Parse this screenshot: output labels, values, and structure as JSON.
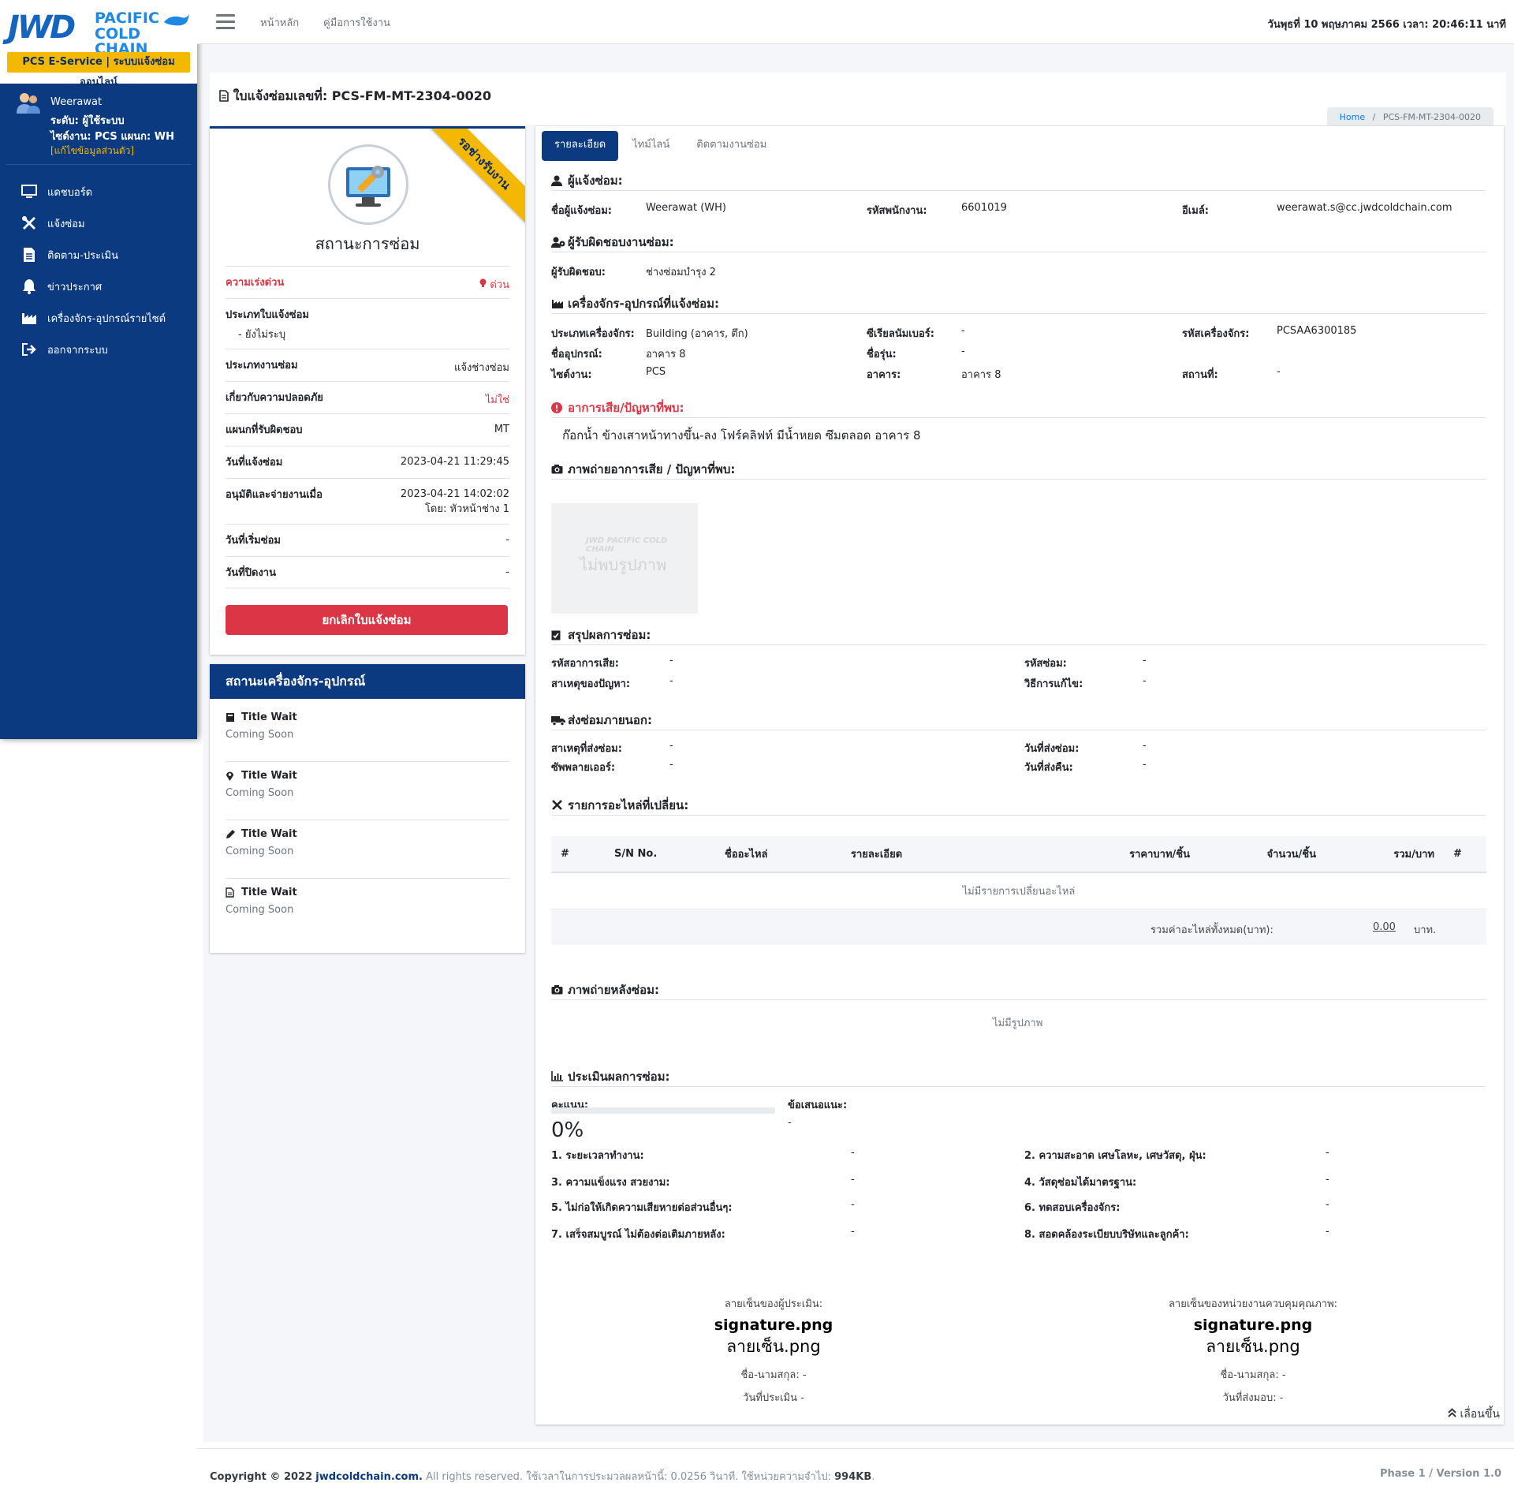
{
  "brand": {
    "jwd": "JWD",
    "pacific": "PACIFIC",
    "cold_chain": "COLD CHAIN",
    "tagline": "PCS E-Service | ระบบแจ้งซ่อมออนไลน์"
  },
  "user": {
    "name": "Weerawat",
    "level": "ระดับ: ผู้ใช้ระบบ",
    "site": "ไซต์งาน: PCS แผนก: WH",
    "edit_link": "[แก้ไขข้อมูลส่วนตัว]"
  },
  "sidebar": {
    "items": [
      {
        "label": "แดชบอร์ด",
        "icon": "monitor-icon"
      },
      {
        "label": "แจ้งซ่อม",
        "icon": "tools-icon"
      },
      {
        "label": "ติดตาม-ประเมิน",
        "icon": "document-icon"
      },
      {
        "label": "ข่าวประกาศ",
        "icon": "bell-icon"
      },
      {
        "label": "เครื่องจักร-อุปกรณ์รายไซต์",
        "icon": "factory-icon"
      },
      {
        "label": "ออกจากระบบ",
        "icon": "sign-out-icon"
      }
    ]
  },
  "topbar": {
    "home": "หน้าหลัก",
    "manual": "คู่มือการใช้งาน",
    "datetime": "วันพุธที่ 10 พฤษภาคม 2566 เวลา: 20:46:11 นาที"
  },
  "header": {
    "title": "ใบแจ้งซ่อมเลขที่: PCS-FM-MT-2304-0020",
    "breadcrumb_home": "Home",
    "breadcrumb_sep": "/",
    "breadcrumb_current": "PCS-FM-MT-2304-0020"
  },
  "status": {
    "ribbon": "รอช่างรับงาน",
    "title": "สถานะการซ่อม",
    "urgency_label": "ความเร่งด่วน",
    "urgency_value": "ด่วน",
    "ticket_type_label": "ประเภทใบแจ้งซ่อม",
    "ticket_type_value": "- ยังไม่ระบุ",
    "job_type_label": "ประเภทงานซ่อม",
    "job_type_value": "แจ้งช่างซ่อม",
    "safety_label": "เกี่ยวกับความปลอดภัย",
    "safety_value": "ไม่ใช่",
    "dept_label": "แผนกที่รับผิดชอบ",
    "dept_value": "MT",
    "report_date_label": "วันที่แจ้งซ่อม",
    "report_date_value": "2023-04-21 11:29:45",
    "approve_label": "อนุมัติและจ่ายงานเมื่อ",
    "approve_value": "2023-04-21 14:02:02",
    "approve_by": "โดย: หัวหน้าช่าง 1",
    "start_label": "วันที่เริ่มซ่อม",
    "start_value": "-",
    "close_label": "วันที่ปิดงาน",
    "close_value": "-",
    "cancel_button": "ยกเลิกใบแจ้งซ่อม",
    "colors": {
      "urgent": "#dc3545",
      "ribbon": "#f5b800"
    }
  },
  "machine_status": {
    "title": "สถานะเครื่องจักร-อุปกรณ์",
    "items": [
      {
        "title": "Title Wait",
        "sub": "Coming Soon",
        "icon": "book-icon"
      },
      {
        "title": "Title Wait",
        "sub": "Coming Soon",
        "icon": "map-marker-icon"
      },
      {
        "title": "Title Wait",
        "sub": "Coming Soon",
        "icon": "pencil-icon"
      },
      {
        "title": "Title Wait",
        "sub": "Coming Soon",
        "icon": "file-icon"
      }
    ]
  },
  "tabs": [
    "รายละเอียด",
    "ไทม์ไลน์",
    "ติดตามงานซ่อม"
  ],
  "reporter": {
    "heading": "ผู้แจ้งซ่อม:",
    "name_label": "ชื่อผู้แจ้งซ่อม:",
    "name_value": "Weerawat (WH)",
    "emp_label": "รหัสพนักงาน:",
    "emp_value": "6601019",
    "email_label": "อีเมล์:",
    "email_value": "weerawat.s@cc.jwdcoldchain.com"
  },
  "responsible": {
    "heading": "ผู้รับผิดชอบงานซ่อม:",
    "label": "ผู้รับผิดชอบ:",
    "value": "ช่างซ่อมบำรุง 2"
  },
  "machine": {
    "heading": "เครื่องจักร-อุปกรณ์ที่แจ้งซ่อม:",
    "type_label": "ประเภทเครื่องจักร:",
    "type_value": "Building (อาคาร, ตึก)",
    "serial_label": "ซีเรียลนัมเบอร์:",
    "serial_value": "-",
    "code_label": "รหัสเครื่องจักร:",
    "code_value": "PCSAA6300185",
    "device_label": "ชื่ออุปกรณ์:",
    "device_value": "อาคาร 8",
    "model_label": "ชื่อรุ่น:",
    "model_value": "-",
    "site_label": "ไซต์งาน:",
    "site_value": "PCS",
    "building_label": "อาคาร:",
    "building_value": "อาคาร 8",
    "place_label": "สถานที่:",
    "place_value": "-"
  },
  "problem": {
    "heading": "อาการเสีย/ปัญหาที่พบ:",
    "text": "ก๊อกน้ำ ข้างเสาหน้าทางขึ้น-ลง โฟร์คลิฟท์ มีน้ำหยด ซึมตลอด อาคาร 8"
  },
  "problem_photo": {
    "heading": "ภาพถ่ายอาการเสีย / ปัญหาที่พบ:",
    "placeholder_logo": "JWD PACIFIC COLD CHAIN",
    "placeholder_text": "ไม่พบรูปภาพ"
  },
  "summary": {
    "heading": "สรุปผลการซ่อม:",
    "fault_code_label": "รหัสอาการเสีย:",
    "fault_code_value": "-",
    "repair_code_label": "รหัสซ่อม:",
    "repair_code_value": "-",
    "cause_label": "สาเหตุของปัญหา:",
    "cause_value": "-",
    "method_label": "วิธีการแก้ไข:",
    "method_value": "-"
  },
  "outsource": {
    "heading": "ส่งซ่อมภายนอก:",
    "reason_label": "สาเหตุที่ส่งซ่อม:",
    "reason_value": "-",
    "send_date_label": "วันที่ส่งซ่อม:",
    "send_date_value": "-",
    "supplier_label": "ซัพพลายเออร์:",
    "supplier_value": "-",
    "return_date_label": "วันที่ส่งคืน:",
    "return_date_value": "-"
  },
  "parts": {
    "heading": "รายการอะไหล่ที่เปลี่ยน:",
    "columns": [
      "#",
      "S/N No.",
      "ชื่ออะไหล่",
      "รายละเอียด",
      "ราคาบาท/ชิ้น",
      "จำนวน/ชิ้น",
      "รวม/บาท",
      "#"
    ],
    "empty": "ไม่มีรายการเปลี่ยนอะไหล่",
    "total_label": "รวมค่าอะไหล่ทั้งหมด(บาท):",
    "total_value": "0.00",
    "total_unit": "บาท."
  },
  "after_photo": {
    "heading": "ภาพถ่ายหลังซ่อม:",
    "empty": "ไม่มีรูปภาพ"
  },
  "evaluation": {
    "heading": "ประเมินผลการซ่อม:",
    "score_label": "คะแนน:",
    "score_percent": 0,
    "score_text": "0%",
    "suggest_label": "ข้อเสนอแนะ:",
    "suggest_value": "-",
    "criteria": [
      {
        "label": "1. ระยะเวลาทำงาน:",
        "value": "-"
      },
      {
        "label": "2. ความสะอาด เศษโลหะ, เศษวัสดุ, ฝุ่น:",
        "value": "-"
      },
      {
        "label": "3. ความแข็งแรง สวยงาม:",
        "value": "-"
      },
      {
        "label": "4. วัสดุซ่อมได้มาตรฐาน:",
        "value": "-"
      },
      {
        "label": "5. ไม่ก่อให้เกิดความเสียหายต่อส่วนอื่นๆ:",
        "value": "-"
      },
      {
        "label": "6. ทดสอบเครื่องจักร:",
        "value": "-"
      },
      {
        "label": "7. เสร็จสมบูรณ์ ไม่ต้องต่อเติมภายหลัง:",
        "value": "-"
      },
      {
        "label": "8. สอดคล้องระเบียบบริษัทและลูกค้า:",
        "value": "-"
      }
    ]
  },
  "signatures": {
    "left": {
      "title": "ลายเซ็นของผู้ประเมิน:",
      "img_alt": "signature.png",
      "img_alt_th": "ลายเซ็น.png",
      "name": "ชื่อ-นามสกุล: -",
      "date": "วันที่ประเมิน -"
    },
    "right": {
      "title": "ลายเซ็นของหน่วยงานควบคุมคุณภาพ:",
      "img_alt": "signature.png",
      "img_alt_th": "ลายเซ็น.png",
      "name": "ชื่อ-นามสกุล: -",
      "date": "วันที่ส่งมอบ: -"
    }
  },
  "scroll_top": "เลื่อนขึ้น",
  "footer": {
    "copyright": "Copyright © 2022",
    "site": "jwdcoldchain.com.",
    "rest": "All rights reserved. ใช้เวลาในการประมวลผลหน้านี้: 0.0256 วินาที. ใช้หน่วยความจำไป:",
    "memory": "994KB",
    "dot": ".",
    "version": "Phase 1 / Version 1.0"
  }
}
